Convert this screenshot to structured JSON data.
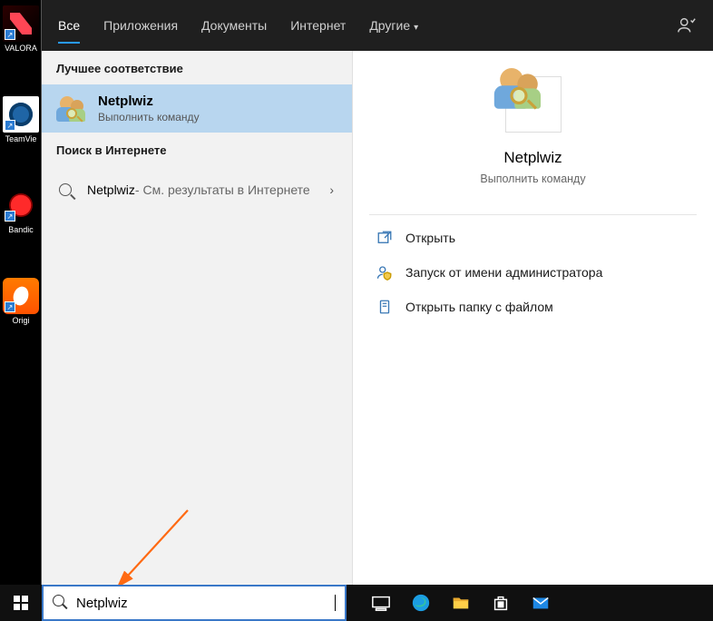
{
  "desktop": {
    "icons": [
      {
        "name": "valorant",
        "label": "VALORA"
      },
      {
        "name": "teamviewer",
        "label": "TeamVie"
      },
      {
        "name": "bandicam",
        "label": "Bandic"
      },
      {
        "name": "origin",
        "label": "Origi"
      }
    ]
  },
  "tabs": {
    "items": [
      "Все",
      "Приложения",
      "Документы",
      "Интернет",
      "Другие"
    ],
    "active_index": 0
  },
  "results": {
    "best_match_header": "Лучшее соответствие",
    "best_match": {
      "title": "Netplwiz",
      "subtitle": "Выполнить команду"
    },
    "web_header": "Поиск в Интернете",
    "web_item": {
      "title": "Netplwiz",
      "suffix": " - См. результаты в Интернете"
    }
  },
  "preview": {
    "title": "Netplwiz",
    "subtitle": "Выполнить команду",
    "actions": [
      {
        "icon": "open",
        "label": "Открыть"
      },
      {
        "icon": "admin",
        "label": "Запуск от имени администратора"
      },
      {
        "icon": "folder",
        "label": "Открыть папку с файлом"
      }
    ]
  },
  "search": {
    "value": "Netplwiz",
    "placeholder": ""
  },
  "taskbar": {
    "icons": [
      "taskview",
      "edge",
      "explorer",
      "store",
      "mail"
    ]
  }
}
